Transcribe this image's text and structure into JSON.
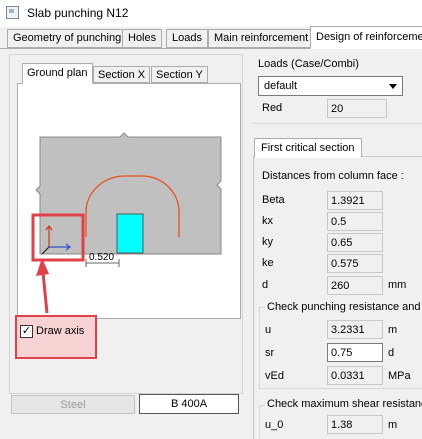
{
  "window": {
    "title": "Slab punching N12"
  },
  "main_tabs": [
    {
      "label": "Geometry of punching"
    },
    {
      "label": "Holes"
    },
    {
      "label": "Loads"
    },
    {
      "label": "Main reinforcement"
    },
    {
      "label": "Design of reinforcemen"
    }
  ],
  "view_tabs": [
    {
      "label": "Ground plan"
    },
    {
      "label": "Section X"
    },
    {
      "label": "Section Y"
    }
  ],
  "drawing": {
    "dimension_label": "0.520"
  },
  "draw_axis": {
    "label": "Draw axis",
    "checked": "✓"
  },
  "steel": {
    "button_label": "Steel",
    "grade": "B 400A"
  },
  "loads": {
    "group_label": "Loads (Case/Combi)",
    "selected": "default",
    "red_label": "Red",
    "red_value": "20"
  },
  "critical_section": {
    "tab_label": "First critical section",
    "distances_heading": "Distances from column face :",
    "rows": [
      {
        "label": "Beta",
        "value": "1.3921",
        "unit": ""
      },
      {
        "label": "kx",
        "value": "0.5",
        "unit": ""
      },
      {
        "label": "ky",
        "value": "0.65",
        "unit": ""
      },
      {
        "label": "ke",
        "value": "0.575",
        "unit": ""
      },
      {
        "label": "d",
        "value": "260",
        "unit": "mm"
      }
    ],
    "punching": {
      "heading": "Check punching resistance and",
      "rows": [
        {
          "label": "u",
          "value": "3.2331",
          "unit": "m"
        },
        {
          "label": "sr",
          "value": "0.75",
          "unit": "d"
        },
        {
          "label": "vEd",
          "value": "0.0331",
          "unit": "MPa"
        }
      ]
    },
    "shear": {
      "heading": "Check maximum shear resistance",
      "rows": [
        {
          "label": "u_0",
          "value": "1.38",
          "unit": "m"
        }
      ]
    }
  },
  "colors": {
    "slab": "#c0c0c0",
    "column": "#00ffff",
    "perimeter": "#e8501e",
    "highlight": "#e0404a"
  }
}
